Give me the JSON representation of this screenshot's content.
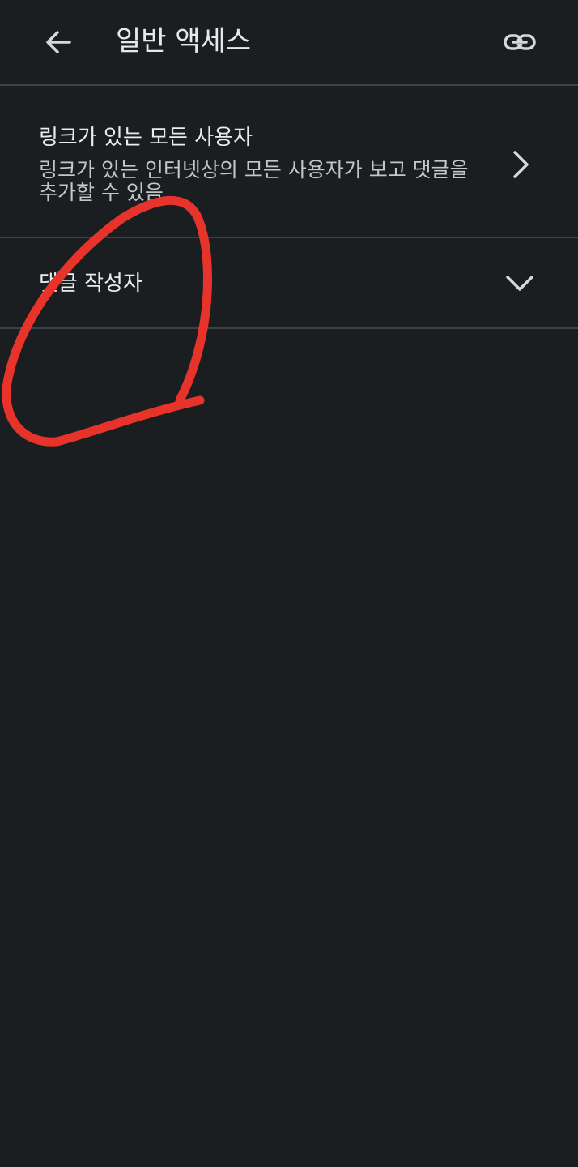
{
  "header": {
    "title": "일반 액세스",
    "back_icon": "arrow-back-icon",
    "link_icon": "link-icon"
  },
  "access": {
    "title": "링크가 있는 모든 사용자",
    "subtitle": "링크가 있는 인터넷상의 모든 사용자가 보고 댓글을 추가할 수 있음",
    "icon": "chevron-right-icon"
  },
  "role": {
    "selected": "댓글 작성자",
    "icon": "chevron-down-icon"
  },
  "colors": {
    "background": "#1b1e21",
    "divider": "#3f4245",
    "text": "#ececec",
    "annotation": "#e8332b"
  }
}
